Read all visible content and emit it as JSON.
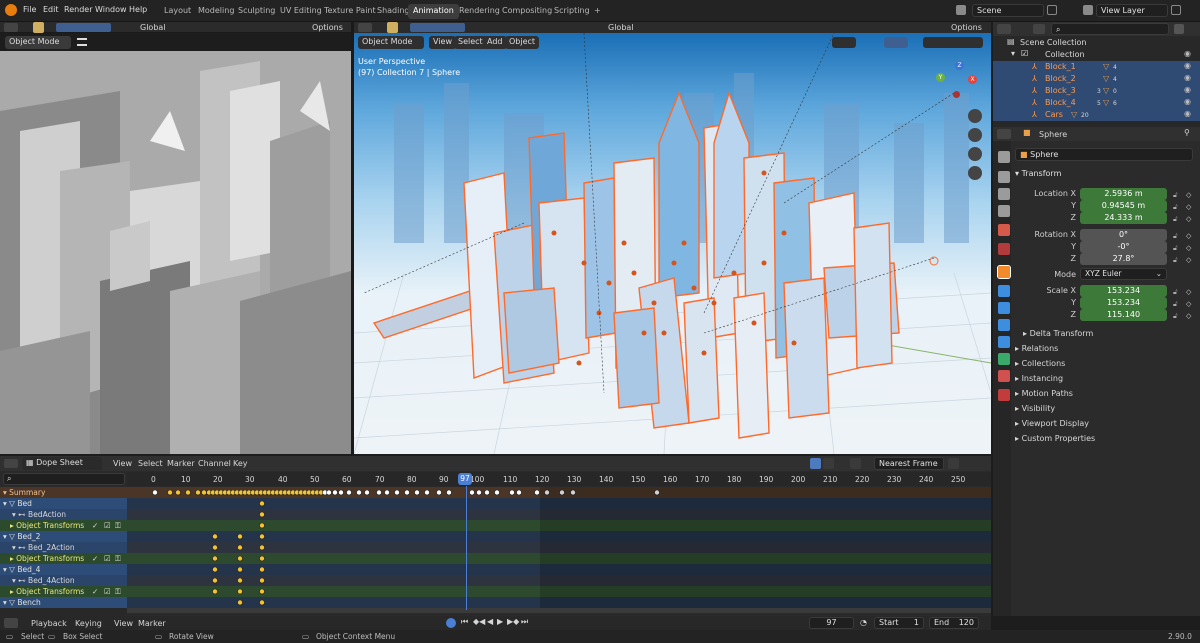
{
  "topbar": {
    "menus": [
      "File",
      "Edit",
      "Render",
      "Window",
      "Help"
    ],
    "workspace_tabs": [
      "Layout",
      "Modeling",
      "Sculpting",
      "UV Editing",
      "Texture Paint",
      "Shading",
      "Animation",
      "Rendering",
      "Compositing",
      "Scripting"
    ],
    "active_tab": "Animation",
    "add_tab": "+",
    "scene": "Scene",
    "view_layer": "View Layer"
  },
  "left_viewport": {
    "transform_orientation": "Global",
    "options": "Options",
    "mode": "Object Mode"
  },
  "right_viewport": {
    "transform_orientation": "Global",
    "options": "Options",
    "mode": "Object Mode",
    "menus": [
      "View",
      "Select",
      "Add",
      "Object"
    ],
    "overlay_title": "User Perspective",
    "overlay_subtitle": "(97) Collection 7 | Sphere",
    "gizmo_axes": [
      "X",
      "Y",
      "Z"
    ]
  },
  "outliner": {
    "search_placeholder": "",
    "items": [
      {
        "label": "Scene Collection"
      },
      {
        "label": "Collection"
      },
      {
        "label": "Block_1",
        "badge1": "",
        "badge2": "4"
      },
      {
        "label": "Block_2",
        "badge1": "",
        "badge2": "4"
      },
      {
        "label": "Block_3",
        "badge1": "3",
        "badge2": "0"
      },
      {
        "label": "Block_4",
        "badge1": "5",
        "badge2": "6"
      },
      {
        "label": "Cars",
        "badge1": "",
        "badge2": "20"
      }
    ]
  },
  "properties": {
    "object_name_header": "Sphere",
    "object_name_field": "Sphere",
    "transform_title": "Transform",
    "location_label": "Location X",
    "location": [
      "2.5936 m",
      "0.94545 m",
      "24.333 m"
    ],
    "rotation_label": "Rotation X",
    "rotation": [
      "0°",
      "-0°",
      "27.8°"
    ],
    "axis_y": "Y",
    "axis_z": "Z",
    "mode_label": "Mode",
    "mode_value": "XYZ Euler",
    "scale_label": "Scale X",
    "scale": [
      "153.234",
      "153.234",
      "115.140"
    ],
    "subpanels": [
      "Delta Transform",
      "Relations",
      "Collections",
      "Instancing",
      "Motion Paths",
      "Visibility",
      "Viewport Display",
      "Custom Properties"
    ]
  },
  "dopesheet": {
    "editor_type": "Dope Sheet",
    "menus": [
      "View",
      "Select",
      "Marker",
      "Channel",
      "Key"
    ],
    "snap_mode": "Nearest Frame",
    "frame_ticks": [
      "0",
      "10",
      "20",
      "30",
      "40",
      "50",
      "60",
      "70",
      "80",
      "90",
      "100",
      "110",
      "120",
      "130",
      "140",
      "150",
      "160",
      "170",
      "180",
      "190",
      "200",
      "210",
      "220",
      "230",
      "240",
      "250"
    ],
    "current_frame_label": "97",
    "channels": [
      {
        "label": "Summary",
        "kind": "summary"
      },
      {
        "label": "Bed",
        "kind": "obj"
      },
      {
        "label": "BedAction",
        "kind": "act"
      },
      {
        "label": "Object Transforms",
        "kind": "grp"
      },
      {
        "label": "Bed_2",
        "kind": "obj"
      },
      {
        "label": "Bed_2Action",
        "kind": "act"
      },
      {
        "label": "Object Transforms",
        "kind": "grp"
      },
      {
        "label": "Bed_4",
        "kind": "obj"
      },
      {
        "label": "Bed_4Action",
        "kind": "act"
      },
      {
        "label": "Object Transforms",
        "kind": "grp"
      },
      {
        "label": "Bench",
        "kind": "obj"
      }
    ]
  },
  "playback": {
    "menus": [
      "Playback",
      "Keying",
      "View",
      "Marker"
    ],
    "current_frame": "97",
    "start_label": "Start",
    "start": "1",
    "end_label": "End",
    "end": "120"
  },
  "statusbar": {
    "items": [
      "Select",
      "Box Select",
      "Rotate View",
      "Object Context Menu"
    ],
    "version": "2.90.0"
  },
  "colors": {
    "accent_green": "#3d7a3a",
    "selection_blue": "#2f4a73",
    "playhead": "#4b7fd6",
    "outline_orange": "#ff6a2a"
  }
}
